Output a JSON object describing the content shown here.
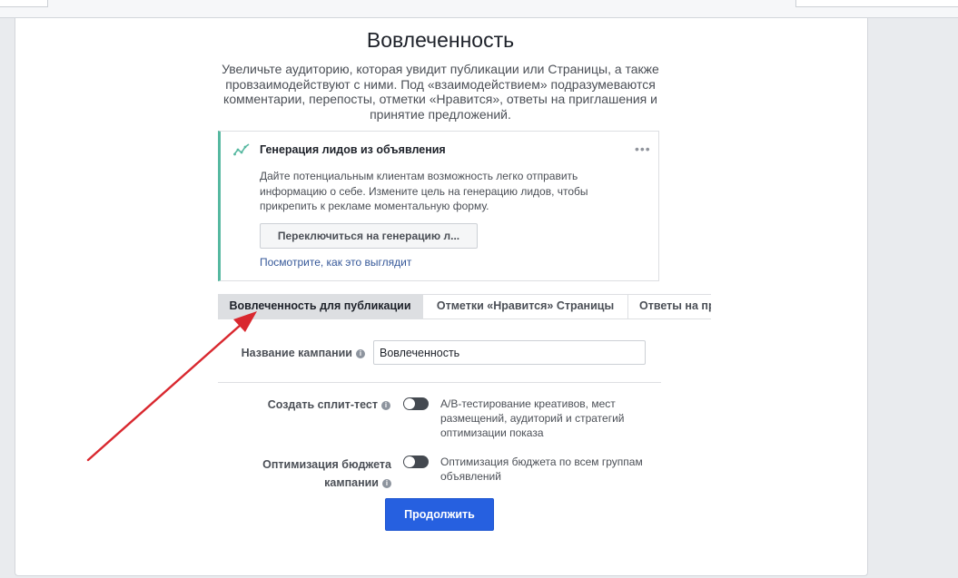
{
  "header": {
    "title": "Вовлеченность",
    "description": "Увеличьте аудиторию, которая увидит публикации или Страницы, а также провзаимодействуют с ними. Под «взаимодействием» подразумеваются комментарии, перепосты, отметки «Нравится», ответы на приглашения и принятие предложений."
  },
  "lead_card": {
    "icon": "trend-line-icon",
    "title": "Генерация лидов из объявления",
    "text": "Дайте потенциальным клиентам возможность легко отправить информацию о себе. Измените цель на генерацию лидов, чтобы прикрепить к рекламе моментальную форму.",
    "button_label": "Переключиться на генерацию л...",
    "link_label": "Посмотрите, как это выглядит",
    "more_icon": "more-dots-icon"
  },
  "tabs": [
    {
      "label": "Вовлеченность для публикации",
      "active": true
    },
    {
      "label": "Отметки «Нравится» Страницы",
      "active": false
    },
    {
      "label": "Ответы на пр",
      "active": false
    }
  ],
  "form": {
    "campaign_name_label": "Название кампании",
    "campaign_name_value": "Вовлеченность",
    "split_test_label": "Создать сплит-тест",
    "split_test_text": "A/B-тестирование креативов, мест размещений, аудиторий и стратегий оптимизации показа",
    "budget_label_line1": "Оптимизация бюджета",
    "budget_label_line2": "кампании",
    "budget_text": "Оптимизация бюджета по всем группам объявлений",
    "info_icon": "i",
    "continue_label": "Продолжить"
  },
  "colors": {
    "accent": "#2660e0",
    "card_border": "#56b8a0",
    "annotation_arrow": "#d9282f"
  }
}
